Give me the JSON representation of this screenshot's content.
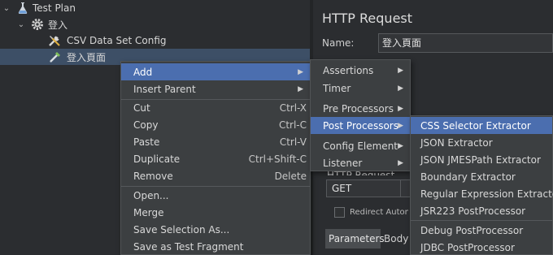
{
  "tree": {
    "test_plan": "Test Plan",
    "login_group": "登入",
    "csv_config": "CSV Data Set Config",
    "login_page": "登入頁面"
  },
  "panel": {
    "title": "HTTP Request",
    "name_label": "Name:",
    "name_value": "登入頁面",
    "http_request_label": "HTTP Request",
    "method": "GET",
    "redirect": "Redirect Automa",
    "tab_parameters": "Parameters",
    "tab_body": "Body"
  },
  "context_menu": {
    "add": "Add",
    "insert_parent": "Insert Parent",
    "cut": "Cut",
    "cut_sc": "Ctrl-X",
    "copy": "Copy",
    "copy_sc": "Ctrl-C",
    "paste": "Paste",
    "paste_sc": "Ctrl-V",
    "duplicate": "Duplicate",
    "duplicate_sc": "Ctrl+Shift-C",
    "remove": "Remove",
    "remove_sc": "Delete",
    "open": "Open...",
    "merge": "Merge",
    "save_selection": "Save Selection As...",
    "save_fragment": "Save as Test Fragment"
  },
  "add_menu": {
    "assertions": "Assertions",
    "timer": "Timer",
    "pre_processors": "Pre Processors",
    "post_processors": "Post Processors",
    "config_element": "Config Element",
    "listener": "Listener"
  },
  "post_menu": {
    "css": "CSS Selector Extractor",
    "json": "JSON Extractor",
    "jmespath": "JSON JMESPath Extractor",
    "boundary": "Boundary Extractor",
    "regex": "Regular Expression Extractor",
    "jsr223": "JSR223 PostProcessor",
    "debug": "Debug PostProcessor",
    "jdbc": "JDBC PostProcessor"
  },
  "colors": {
    "highlight": "#4b6eaf",
    "tree_selection": "#3d4f66",
    "background": "#2b2d30",
    "menu_bg": "#3c3f41"
  }
}
